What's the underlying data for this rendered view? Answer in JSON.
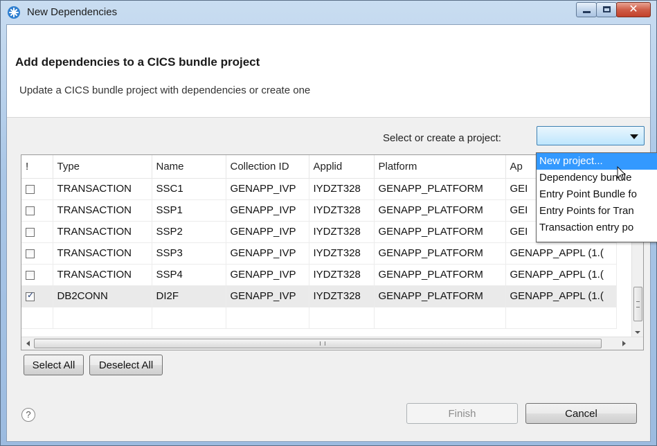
{
  "window": {
    "title": "New Dependencies"
  },
  "header": {
    "title": "Add dependencies to a CICS bundle project",
    "description": "Update a CICS bundle project with dependencies or create one"
  },
  "project": {
    "label": "Select or create a project:",
    "selected": ""
  },
  "table": {
    "columns": [
      "!",
      "Type",
      "Name",
      "Collection ID",
      "Applid",
      "Platform",
      "Ap"
    ],
    "rows": [
      {
        "checked": false,
        "type": "TRANSACTION",
        "name": "SSC1",
        "collection": "GENAPP_IVP",
        "applid": "IYDZT328",
        "platform": "GENAPP_PLATFORM",
        "app": "GEI"
      },
      {
        "checked": false,
        "type": "TRANSACTION",
        "name": "SSP1",
        "collection": "GENAPP_IVP",
        "applid": "IYDZT328",
        "platform": "GENAPP_PLATFORM",
        "app": "GEI"
      },
      {
        "checked": false,
        "type": "TRANSACTION",
        "name": "SSP2",
        "collection": "GENAPP_IVP",
        "applid": "IYDZT328",
        "platform": "GENAPP_PLATFORM",
        "app": "GEI"
      },
      {
        "checked": false,
        "type": "TRANSACTION",
        "name": "SSP3",
        "collection": "GENAPP_IVP",
        "applid": "IYDZT328",
        "platform": "GENAPP_PLATFORM",
        "app": "GENAPP_APPL (1.("
      },
      {
        "checked": false,
        "type": "TRANSACTION",
        "name": "SSP4",
        "collection": "GENAPP_IVP",
        "applid": "IYDZT328",
        "platform": "GENAPP_PLATFORM",
        "app": "GENAPP_APPL (1.("
      },
      {
        "checked": true,
        "type": "DB2CONN",
        "name": "DI2F",
        "collection": "GENAPP_IVP",
        "applid": "IYDZT328",
        "platform": "GENAPP_PLATFORM",
        "app": "GENAPP_APPL (1.("
      }
    ]
  },
  "dropdown": {
    "items": [
      "New project...",
      "Dependency bundle",
      "Entry Point Bundle fo",
      "Entry Points for Tran",
      "Transaction entry po"
    ],
    "highlighted": 0
  },
  "buttons": {
    "select_all": "Select All",
    "deselect_all": "Deselect All",
    "finish": "Finish",
    "cancel": "Cancel",
    "help": "?"
  },
  "scrollbar": {
    "h_grip": "III"
  },
  "colors": {
    "selection": "#3399ff",
    "title_bar": "#a9c6e6",
    "close_button": "#c2412b"
  },
  "icons": [
    "app-icon",
    "minimize-icon",
    "maximize-icon",
    "close-icon",
    "help-icon",
    "dropdown-arrow-icon",
    "checkbox-icon",
    "mouse-cursor-icon"
  ]
}
